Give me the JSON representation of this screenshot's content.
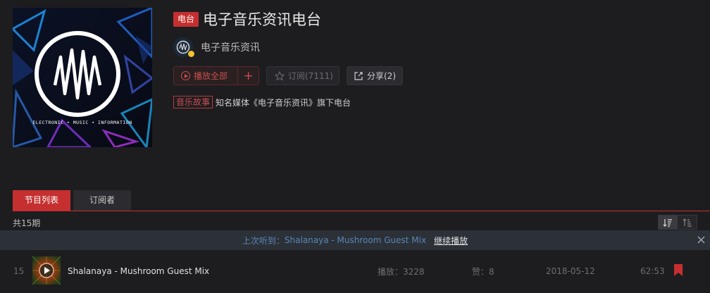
{
  "radio": {
    "tag": "电台",
    "title": "电子音乐资讯电台",
    "owner_name": "电子音乐资讯",
    "cover_text": "ELECTRONIC • MUSIC • INFORMATION"
  },
  "actions": {
    "play_all": "播放全部",
    "add": "+",
    "subscribe": "订阅(7111)",
    "share": "分享(2)"
  },
  "description": {
    "category": "音乐故事",
    "text": "知名媒体《电子音乐资讯》旗下电台"
  },
  "tabs": [
    {
      "label": "节目列表",
      "active": true
    },
    {
      "label": "订阅者",
      "active": false
    }
  ],
  "count_label": "共15期",
  "resume": {
    "prefix": "上次听到：",
    "title": "Shalanaya - Mushroom Guest Mix",
    "link": "继续播放"
  },
  "programs": [
    {
      "index": "15",
      "name": "Shalanaya - Mushroom Guest Mix",
      "plays": "播放：3228",
      "likes": "赞：8",
      "date": "2018-05-12",
      "duration": "62:53"
    }
  ],
  "colors": {
    "accent": "#c62f2f",
    "background": "#1d1d20",
    "link_blue": "#5a86b7"
  }
}
